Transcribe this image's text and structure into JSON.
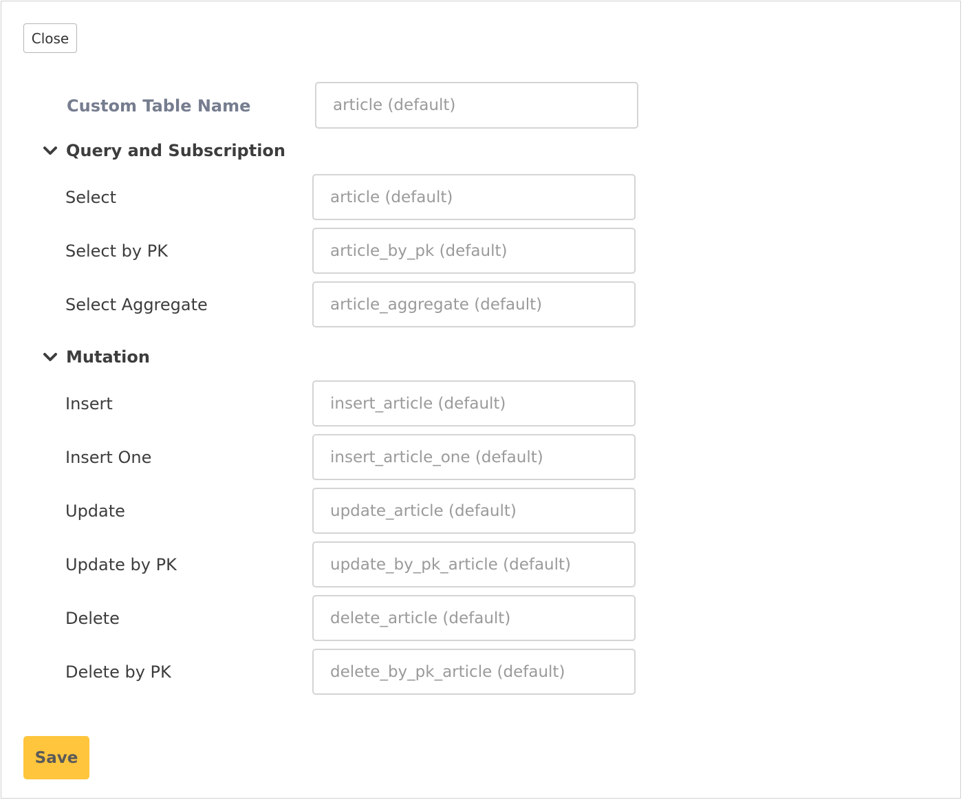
{
  "toolbar": {
    "close_label": "Close"
  },
  "custom_table_name": {
    "label": "Custom Table Name",
    "placeholder": "article (default)",
    "value": ""
  },
  "sections": {
    "query": {
      "title": "Query and Subscription",
      "icon": "chevron-down-icon",
      "expanded": true,
      "rows": [
        {
          "label": "Select",
          "placeholder": "article (default)",
          "value": ""
        },
        {
          "label": "Select by PK",
          "placeholder": "article_by_pk (default)",
          "value": ""
        },
        {
          "label": "Select Aggregate",
          "placeholder": "article_aggregate (default)",
          "value": ""
        }
      ]
    },
    "mutation": {
      "title": "Mutation",
      "icon": "chevron-down-icon",
      "expanded": true,
      "rows": [
        {
          "label": "Insert",
          "placeholder": "insert_article (default)",
          "value": ""
        },
        {
          "label": "Insert One",
          "placeholder": "insert_article_one (default)",
          "value": ""
        },
        {
          "label": "Update",
          "placeholder": "update_article (default)",
          "value": ""
        },
        {
          "label": "Update by PK",
          "placeholder": "update_by_pk_article (default)",
          "value": ""
        },
        {
          "label": "Delete",
          "placeholder": "delete_article (default)",
          "value": ""
        },
        {
          "label": "Delete by PK",
          "placeholder": "delete_by_pk_article (default)",
          "value": ""
        }
      ]
    }
  },
  "footer": {
    "save_label": "Save"
  },
  "colors": {
    "save_button": "#fec53d",
    "custom_label": "#767d8f",
    "text": "#3d3d3d",
    "placeholder": "#9a9a9a",
    "border": "#d4d4d4"
  }
}
